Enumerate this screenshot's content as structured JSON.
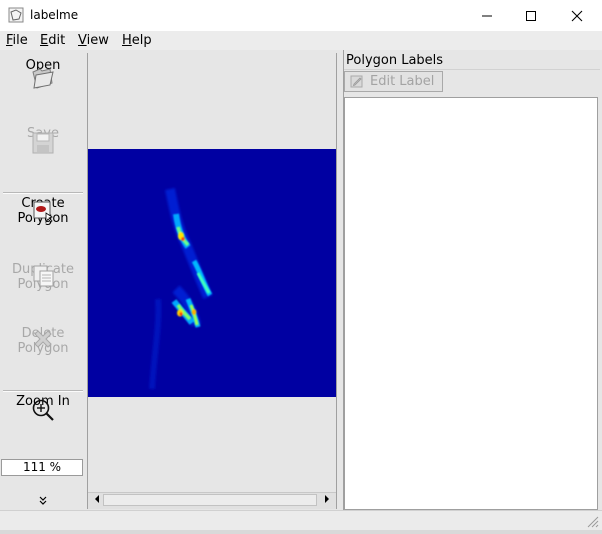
{
  "window": {
    "title": "labelme",
    "icons": {
      "app": "labelme-icon",
      "minimize": "minimize-icon",
      "maximize": "maximize-icon",
      "close": "close-icon"
    }
  },
  "menu": [
    {
      "label": "File",
      "mnemonic": "F",
      "rest": "ile"
    },
    {
      "label": "Edit",
      "mnemonic": "E",
      "rest": "dit"
    },
    {
      "label": "View",
      "mnemonic": "V",
      "rest": "iew"
    },
    {
      "label": "Help",
      "mnemonic": "H",
      "rest": "elp"
    }
  ],
  "toolbar": {
    "open": {
      "label": "Open",
      "icon": "folder-open-icon",
      "enabled": true
    },
    "save": {
      "label": "Save",
      "icon": "floppy-disk-icon",
      "enabled": false
    },
    "create_polygon": {
      "line1": "Create",
      "line2": "Polygon",
      "icon": "create-polygon-icon",
      "enabled": true
    },
    "duplicate_polygon": {
      "line1": "Duplicate",
      "line2": "Polygon",
      "icon": "duplicate-icon",
      "enabled": false
    },
    "delete_polygon": {
      "line1": "Delete",
      "line2": "Polygon",
      "icon": "delete-x-icon",
      "enabled": false
    },
    "zoom_in": {
      "label": "Zoom In",
      "icon": "zoom-in-icon",
      "enabled": true
    },
    "zoom_value": "111 %",
    "extension_icon": "chevron-double-down-icon"
  },
  "canvas": {
    "image": "spectrogram heatmap",
    "background_color": "#0000a2"
  },
  "dock": {
    "title": "Polygon Labels",
    "edit_label_button": "Edit Label",
    "edit_label_icon": "edit-label-icon",
    "enabled": false
  }
}
